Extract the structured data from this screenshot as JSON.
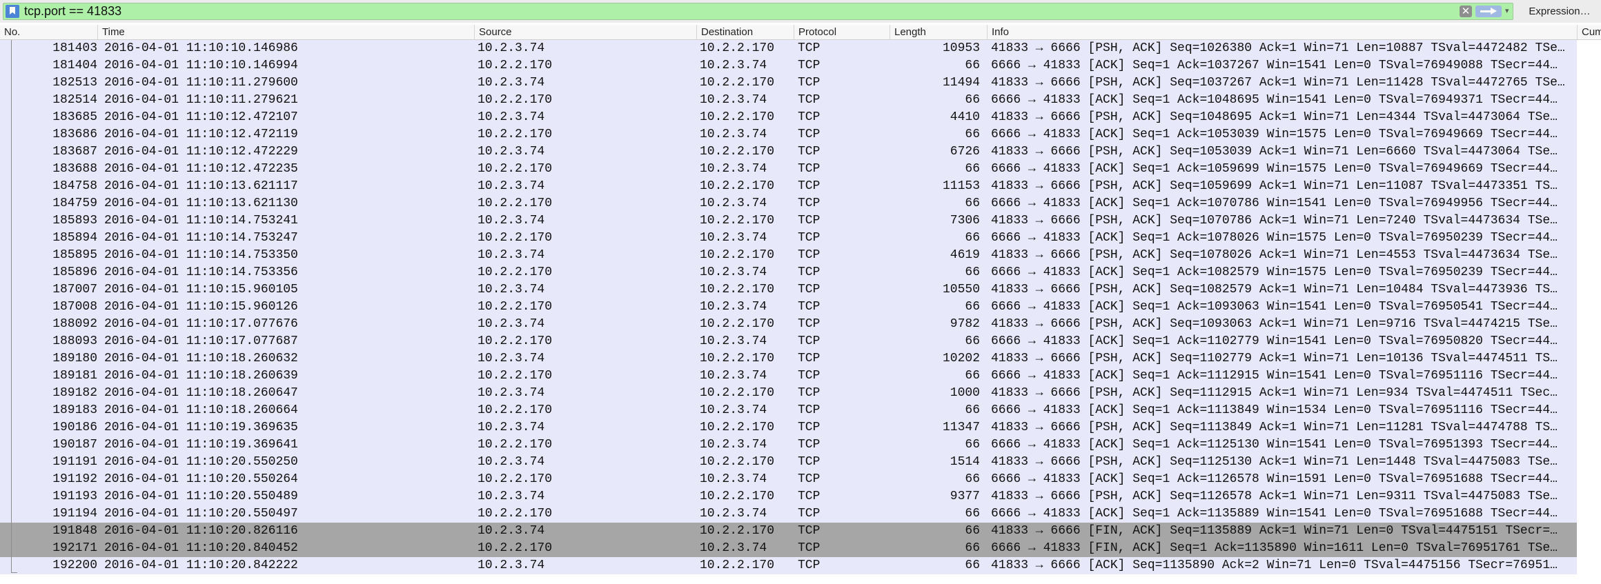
{
  "filter": {
    "value": "tcp.port == 41833",
    "clear_glyph": "✕",
    "dropdown_glyph": "▾",
    "expression_label": "Expression…",
    "icons": {
      "bookmark": "bookmark-icon",
      "clear": "clear-icon",
      "apply": "apply-arrow-icon",
      "dropdown": "chevron-down-icon"
    },
    "bg_color": "#aff0a8"
  },
  "columns": [
    {
      "key": "no",
      "label": "No."
    },
    {
      "key": "time",
      "label": "Time"
    },
    {
      "key": "source",
      "label": "Source"
    },
    {
      "key": "destination",
      "label": "Destination"
    },
    {
      "key": "protocol",
      "label": "Protocol"
    },
    {
      "key": "length",
      "label": "Length"
    },
    {
      "key": "info",
      "label": "Info"
    },
    {
      "key": "cum",
      "label": "Cum"
    }
  ],
  "colors": {
    "row_default": "#e8e8fb",
    "row_marked": "#a6a6a6"
  },
  "rows": [
    {
      "no": "181403",
      "time": "2016-04-01 11:10:10.146986",
      "src": "10.2.3.74",
      "dst": "10.2.2.170",
      "proto": "TCP",
      "len": "10953",
      "info": "41833 → 6666 [PSH, ACK] Seq=1026380 Ack=1 Win=71 Len=10887 TSval=4472482 TSe…",
      "marked": false
    },
    {
      "no": "181404",
      "time": "2016-04-01 11:10:10.146994",
      "src": "10.2.2.170",
      "dst": "10.2.3.74",
      "proto": "TCP",
      "len": "66",
      "info": "6666 → 41833 [ACK] Seq=1 Ack=1037267 Win=1541 Len=0 TSval=76949088 TSecr=44…",
      "marked": false
    },
    {
      "no": "182513",
      "time": "2016-04-01 11:10:11.279600",
      "src": "10.2.3.74",
      "dst": "10.2.2.170",
      "proto": "TCP",
      "len": "11494",
      "info": "41833 → 6666 [PSH, ACK] Seq=1037267 Ack=1 Win=71 Len=11428 TSval=4472765 TSe…",
      "marked": false
    },
    {
      "no": "182514",
      "time": "2016-04-01 11:10:11.279621",
      "src": "10.2.2.170",
      "dst": "10.2.3.74",
      "proto": "TCP",
      "len": "66",
      "info": "6666 → 41833 [ACK] Seq=1 Ack=1048695 Win=1541 Len=0 TSval=76949371 TSecr=44…",
      "marked": false
    },
    {
      "no": "183685",
      "time": "2016-04-01 11:10:12.472107",
      "src": "10.2.3.74",
      "dst": "10.2.2.170",
      "proto": "TCP",
      "len": "4410",
      "info": "41833 → 6666 [PSH, ACK] Seq=1048695 Ack=1 Win=71 Len=4344 TSval=4473064 TSe…",
      "marked": false
    },
    {
      "no": "183686",
      "time": "2016-04-01 11:10:12.472119",
      "src": "10.2.2.170",
      "dst": "10.2.3.74",
      "proto": "TCP",
      "len": "66",
      "info": "6666 → 41833 [ACK] Seq=1 Ack=1053039 Win=1575 Len=0 TSval=76949669 TSecr=44…",
      "marked": false
    },
    {
      "no": "183687",
      "time": "2016-04-01 11:10:12.472229",
      "src": "10.2.3.74",
      "dst": "10.2.2.170",
      "proto": "TCP",
      "len": "6726",
      "info": "41833 → 6666 [PSH, ACK] Seq=1053039 Ack=1 Win=71 Len=6660 TSval=4473064 TSe…",
      "marked": false
    },
    {
      "no": "183688",
      "time": "2016-04-01 11:10:12.472235",
      "src": "10.2.2.170",
      "dst": "10.2.3.74",
      "proto": "TCP",
      "len": "66",
      "info": "6666 → 41833 [ACK] Seq=1 Ack=1059699 Win=1575 Len=0 TSval=76949669 TSecr=44…",
      "marked": false
    },
    {
      "no": "184758",
      "time": "2016-04-01 11:10:13.621117",
      "src": "10.2.3.74",
      "dst": "10.2.2.170",
      "proto": "TCP",
      "len": "11153",
      "info": "41833 → 6666 [PSH, ACK] Seq=1059699 Ack=1 Win=71 Len=11087 TSval=4473351 TS…",
      "marked": false
    },
    {
      "no": "184759",
      "time": "2016-04-01 11:10:13.621130",
      "src": "10.2.2.170",
      "dst": "10.2.3.74",
      "proto": "TCP",
      "len": "66",
      "info": "6666 → 41833 [ACK] Seq=1 Ack=1070786 Win=1541 Len=0 TSval=76949956 TSecr=44…",
      "marked": false
    },
    {
      "no": "185893",
      "time": "2016-04-01 11:10:14.753241",
      "src": "10.2.3.74",
      "dst": "10.2.2.170",
      "proto": "TCP",
      "len": "7306",
      "info": "41833 → 6666 [PSH, ACK] Seq=1070786 Ack=1 Win=71 Len=7240 TSval=4473634 TSe…",
      "marked": false
    },
    {
      "no": "185894",
      "time": "2016-04-01 11:10:14.753247",
      "src": "10.2.2.170",
      "dst": "10.2.3.74",
      "proto": "TCP",
      "len": "66",
      "info": "6666 → 41833 [ACK] Seq=1 Ack=1078026 Win=1575 Len=0 TSval=76950239 TSecr=44…",
      "marked": false
    },
    {
      "no": "185895",
      "time": "2016-04-01 11:10:14.753350",
      "src": "10.2.3.74",
      "dst": "10.2.2.170",
      "proto": "TCP",
      "len": "4619",
      "info": "41833 → 6666 [PSH, ACK] Seq=1078026 Ack=1 Win=71 Len=4553 TSval=4473634 TSe…",
      "marked": false
    },
    {
      "no": "185896",
      "time": "2016-04-01 11:10:14.753356",
      "src": "10.2.2.170",
      "dst": "10.2.3.74",
      "proto": "TCP",
      "len": "66",
      "info": "6666 → 41833 [ACK] Seq=1 Ack=1082579 Win=1575 Len=0 TSval=76950239 TSecr=44…",
      "marked": false
    },
    {
      "no": "187007",
      "time": "2016-04-01 11:10:15.960105",
      "src": "10.2.3.74",
      "dst": "10.2.2.170",
      "proto": "TCP",
      "len": "10550",
      "info": "41833 → 6666 [PSH, ACK] Seq=1082579 Ack=1 Win=71 Len=10484 TSval=4473936 TS…",
      "marked": false
    },
    {
      "no": "187008",
      "time": "2016-04-01 11:10:15.960126",
      "src": "10.2.2.170",
      "dst": "10.2.3.74",
      "proto": "TCP",
      "len": "66",
      "info": "6666 → 41833 [ACK] Seq=1 Ack=1093063 Win=1541 Len=0 TSval=76950541 TSecr=44…",
      "marked": false
    },
    {
      "no": "188092",
      "time": "2016-04-01 11:10:17.077676",
      "src": "10.2.3.74",
      "dst": "10.2.2.170",
      "proto": "TCP",
      "len": "9782",
      "info": "41833 → 6666 [PSH, ACK] Seq=1093063 Ack=1 Win=71 Len=9716 TSval=4474215 TSe…",
      "marked": false
    },
    {
      "no": "188093",
      "time": "2016-04-01 11:10:17.077687",
      "src": "10.2.2.170",
      "dst": "10.2.3.74",
      "proto": "TCP",
      "len": "66",
      "info": "6666 → 41833 [ACK] Seq=1 Ack=1102779 Win=1541 Len=0 TSval=76950820 TSecr=44…",
      "marked": false
    },
    {
      "no": "189180",
      "time": "2016-04-01 11:10:18.260632",
      "src": "10.2.3.74",
      "dst": "10.2.2.170",
      "proto": "TCP",
      "len": "10202",
      "info": "41833 → 6666 [PSH, ACK] Seq=1102779 Ack=1 Win=71 Len=10136 TSval=4474511 TS…",
      "marked": false
    },
    {
      "no": "189181",
      "time": "2016-04-01 11:10:18.260639",
      "src": "10.2.2.170",
      "dst": "10.2.3.74",
      "proto": "TCP",
      "len": "66",
      "info": "6666 → 41833 [ACK] Seq=1 Ack=1112915 Win=1541 Len=0 TSval=76951116 TSecr=44…",
      "marked": false
    },
    {
      "no": "189182",
      "time": "2016-04-01 11:10:18.260647",
      "src": "10.2.3.74",
      "dst": "10.2.2.170",
      "proto": "TCP",
      "len": "1000",
      "info": "41833 → 6666 [PSH, ACK] Seq=1112915 Ack=1 Win=71 Len=934 TSval=4474511 TSec…",
      "marked": false
    },
    {
      "no": "189183",
      "time": "2016-04-01 11:10:18.260664",
      "src": "10.2.2.170",
      "dst": "10.2.3.74",
      "proto": "TCP",
      "len": "66",
      "info": "6666 → 41833 [ACK] Seq=1 Ack=1113849 Win=1534 Len=0 TSval=76951116 TSecr=44…",
      "marked": false
    },
    {
      "no": "190186",
      "time": "2016-04-01 11:10:19.369635",
      "src": "10.2.3.74",
      "dst": "10.2.2.170",
      "proto": "TCP",
      "len": "11347",
      "info": "41833 → 6666 [PSH, ACK] Seq=1113849 Ack=1 Win=71 Len=11281 TSval=4474788 TS…",
      "marked": false
    },
    {
      "no": "190187",
      "time": "2016-04-01 11:10:19.369641",
      "src": "10.2.2.170",
      "dst": "10.2.3.74",
      "proto": "TCP",
      "len": "66",
      "info": "6666 → 41833 [ACK] Seq=1 Ack=1125130 Win=1541 Len=0 TSval=76951393 TSecr=44…",
      "marked": false
    },
    {
      "no": "191191",
      "time": "2016-04-01 11:10:20.550250",
      "src": "10.2.3.74",
      "dst": "10.2.2.170",
      "proto": "TCP",
      "len": "1514",
      "info": "41833 → 6666 [PSH, ACK] Seq=1125130 Ack=1 Win=71 Len=1448 TSval=4475083 TSe…",
      "marked": false
    },
    {
      "no": "191192",
      "time": "2016-04-01 11:10:20.550264",
      "src": "10.2.2.170",
      "dst": "10.2.3.74",
      "proto": "TCP",
      "len": "66",
      "info": "6666 → 41833 [ACK] Seq=1 Ack=1126578 Win=1591 Len=0 TSval=76951688 TSecr=44…",
      "marked": false
    },
    {
      "no": "191193",
      "time": "2016-04-01 11:10:20.550489",
      "src": "10.2.3.74",
      "dst": "10.2.2.170",
      "proto": "TCP",
      "len": "9377",
      "info": "41833 → 6666 [PSH, ACK] Seq=1126578 Ack=1 Win=71 Len=9311 TSval=4475083 TSe…",
      "marked": false
    },
    {
      "no": "191194",
      "time": "2016-04-01 11:10:20.550497",
      "src": "10.2.2.170",
      "dst": "10.2.3.74",
      "proto": "TCP",
      "len": "66",
      "info": "6666 → 41833 [ACK] Seq=1 Ack=1135889 Win=1541 Len=0 TSval=76951688 TSecr=44…",
      "marked": false
    },
    {
      "no": "191848",
      "time": "2016-04-01 11:10:20.826116",
      "src": "10.2.3.74",
      "dst": "10.2.2.170",
      "proto": "TCP",
      "len": "66",
      "info": "41833 → 6666 [FIN, ACK] Seq=1135889 Ack=1 Win=71 Len=0 TSval=4475151 TSecr=…",
      "marked": true
    },
    {
      "no": "192171",
      "time": "2016-04-01 11:10:20.840452",
      "src": "10.2.2.170",
      "dst": "10.2.3.74",
      "proto": "TCP",
      "len": "66",
      "info": "6666 → 41833 [FIN, ACK] Seq=1 Ack=1135890 Win=1611 Len=0 TSval=76951761 TSe…",
      "marked": true
    },
    {
      "no": "192200",
      "time": "2016-04-01 11:10:20.842222",
      "src": "10.2.3.74",
      "dst": "10.2.2.170",
      "proto": "TCP",
      "len": "66",
      "info": "41833 → 6666 [ACK] Seq=1135890 Ack=2 Win=71 Len=0 TSval=4475156 TSecr=76951…",
      "marked": false
    }
  ]
}
